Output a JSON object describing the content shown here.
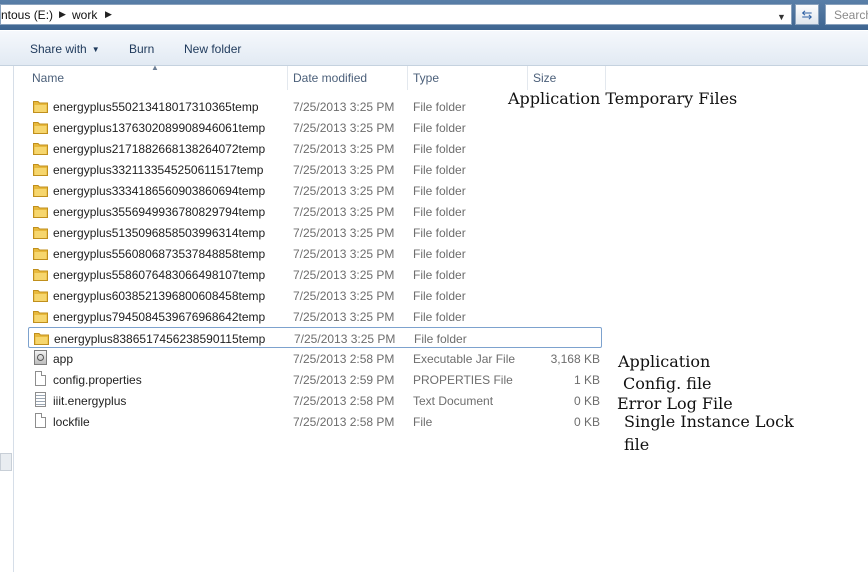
{
  "address_bar": {
    "crumbs": [
      "ntous (E:)",
      "work"
    ],
    "search_placeholder": "Search"
  },
  "toolbar": {
    "share_with": "Share with",
    "burn": "Burn",
    "new_folder": "New folder"
  },
  "columns": {
    "name": "Name",
    "date_modified": "Date modified",
    "type": "Type",
    "size": "Size"
  },
  "rows": [
    {
      "name": "energyplus5502134180173103​65temp",
      "date": "7/25/2013 3:25 PM",
      "type": "File folder",
      "size": "",
      "icon": "folder-icon"
    },
    {
      "name": "energyplus1376302089908946061temp",
      "date": "7/25/2013 3:25 PM",
      "type": "File folder",
      "size": "",
      "icon": "folder-icon"
    },
    {
      "name": "energyplus2171882668138264072temp",
      "date": "7/25/2013 3:25 PM",
      "type": "File folder",
      "size": "",
      "icon": "folder-icon"
    },
    {
      "name": "energyplus3321133545250611517temp",
      "date": "7/25/2013 3:25 PM",
      "type": "File folder",
      "size": "",
      "icon": "folder-icon"
    },
    {
      "name": "energyplus3334186560903860694temp",
      "date": "7/25/2013 3:25 PM",
      "type": "File folder",
      "size": "",
      "icon": "folder-icon"
    },
    {
      "name": "energyplus3556949936780829794temp",
      "date": "7/25/2013 3:25 PM",
      "type": "File folder",
      "size": "",
      "icon": "folder-icon"
    },
    {
      "name": "energyplus5135096858503996314temp",
      "date": "7/25/2013 3:25 PM",
      "type": "File folder",
      "size": "",
      "icon": "folder-icon"
    },
    {
      "name": "energyplus5560806873537848858temp",
      "date": "7/25/2013 3:25 PM",
      "type": "File folder",
      "size": "",
      "icon": "folder-icon"
    },
    {
      "name": "energyplus5586076483066498107temp",
      "date": "7/25/2013 3:25 PM",
      "type": "File folder",
      "size": "",
      "icon": "folder-icon"
    },
    {
      "name": "energyplus6038521396800608458temp",
      "date": "7/25/2013 3:25 PM",
      "type": "File folder",
      "size": "",
      "icon": "folder-icon"
    },
    {
      "name": "energyplus7945084539676968642temp",
      "date": "7/25/2013 3:25 PM",
      "type": "File folder",
      "size": "",
      "icon": "folder-icon"
    },
    {
      "name": "energyplus8386517456238590115temp",
      "date": "7/25/2013 3:25 PM",
      "type": "File folder",
      "size": "",
      "icon": "folder-icon",
      "selected": true
    },
    {
      "name": "app",
      "date": "7/25/2013 2:58 PM",
      "type": "Executable Jar File",
      "size": "3,168 KB",
      "icon": "jar-file-icon"
    },
    {
      "name": "config.properties",
      "date": "7/25/2013 2:59 PM",
      "type": "PROPERTIES File",
      "size": "1 KB",
      "icon": "file-icon"
    },
    {
      "name": "iiit.energyplus",
      "date": "7/25/2013 2:58 PM",
      "type": "Text Document",
      "size": "0 KB",
      "icon": "text-document-icon"
    },
    {
      "name": "lockfile",
      "date": "7/25/2013 2:58 PM",
      "type": "File",
      "size": "0 KB",
      "icon": "file-icon"
    }
  ],
  "annotations": {
    "temp_files": "Application Temporary Files",
    "application": "Application",
    "config": "Config. file",
    "error_log": "Error Log File",
    "lock_line1": "Single Instance Lock",
    "lock_line2": "file"
  },
  "colors": {
    "folder": "#e8b93c",
    "selection_border": "#7da2ce",
    "header_text": "#4c607a"
  }
}
